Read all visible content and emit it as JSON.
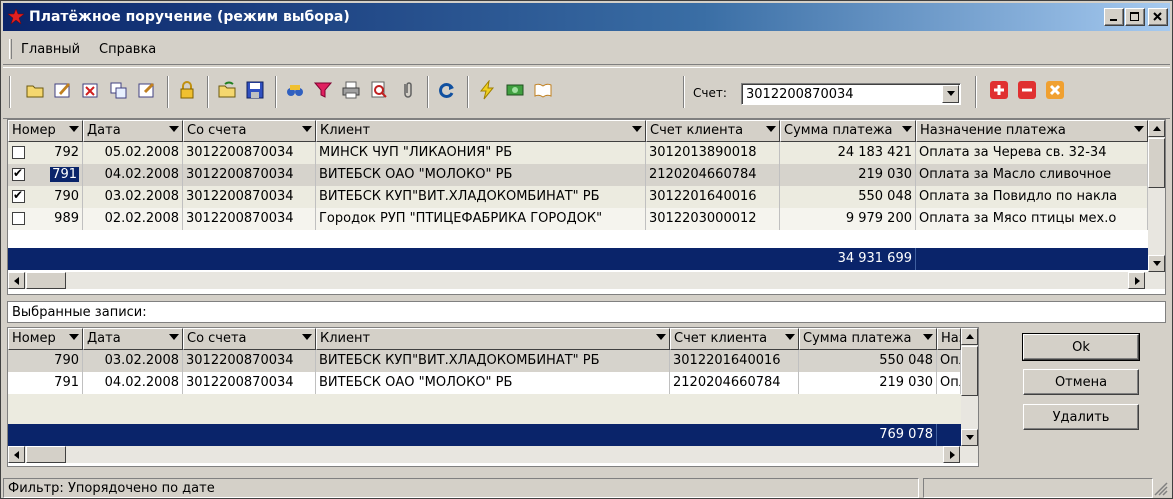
{
  "window": {
    "title": "Платёжное поручение (режим выбора)",
    "icon": "app-star-icon"
  },
  "menu": [
    "Главный",
    "Справка"
  ],
  "toolbar": {
    "account_label": "Счет:",
    "account_value": "3012200870034"
  },
  "top_grid": {
    "columns": [
      "Номер",
      "Дата",
      "Со счета",
      "Клиент",
      "Счет клиента",
      "Сумма платежа",
      "Назначение платежа"
    ],
    "rows": [
      {
        "checked": false,
        "num": "792",
        "date": "05.02.2008",
        "from": "3012200870034",
        "client": "МИНСК ЧУП \"ЛИКАОНИЯ\" РБ",
        "acct": "3012013890018",
        "sum": "24 183 421",
        "purpose": "Оплата за Черева св. 32-34"
      },
      {
        "checked": true,
        "num": "791",
        "date": "04.02.2008",
        "from": "3012200870034",
        "client": "ВИТЕБСК ОАО \"МОЛОКО\" РБ",
        "acct": "2120204660784",
        "sum": "219 030",
        "purpose": "Оплата за Масло сливочное"
      },
      {
        "checked": true,
        "num": "790",
        "date": "03.02.2008",
        "from": "3012200870034",
        "client": "ВИТЕБСК КУП\"ВИТ.ХЛАДОКОМБИНАТ\" РБ",
        "acct": "3012201640016",
        "sum": "550 048",
        "purpose": "Оплата за Повидло по накла"
      },
      {
        "checked": false,
        "num": "989",
        "date": "02.02.2008",
        "from": "3012200870034",
        "client": "Городок РУП \"ПТИЦЕФАБРИКА ГОРОДОК\"",
        "acct": "3012203000012",
        "sum": "9 979 200",
        "purpose": "Оплата за Мясо птицы мех.о"
      }
    ],
    "total": "34 931 699"
  },
  "selected_label": "Выбранные записи:",
  "bottom_grid": {
    "columns": [
      "Номер",
      "Дата",
      "Со счета",
      "Клиент",
      "Счет клиента",
      "Сумма платежа",
      "Назн"
    ],
    "rows": [
      {
        "num": "790",
        "date": "03.02.2008",
        "from": "3012200870034",
        "client": "ВИТЕБСК КУП\"ВИТ.ХЛАДОКОМБИНАТ\" РБ",
        "acct": "3012201640016",
        "sum": "550 048",
        "purpose": "Опла"
      },
      {
        "num": "791",
        "date": "04.02.2008",
        "from": "3012200870034",
        "client": "ВИТЕБСК ОАО \"МОЛОКО\" РБ",
        "acct": "2120204660784",
        "sum": "219 030",
        "purpose": "Опла"
      }
    ],
    "total": "769 078"
  },
  "buttons": {
    "ok": "Ok",
    "cancel": "Отмена",
    "delete": "Удалить"
  },
  "status": {
    "filter": "Фильтр: Упорядочено по дате"
  },
  "colors": {
    "title_bar": "#0a246a",
    "total_row": "#0a246a",
    "face": "#d4d0c8"
  }
}
